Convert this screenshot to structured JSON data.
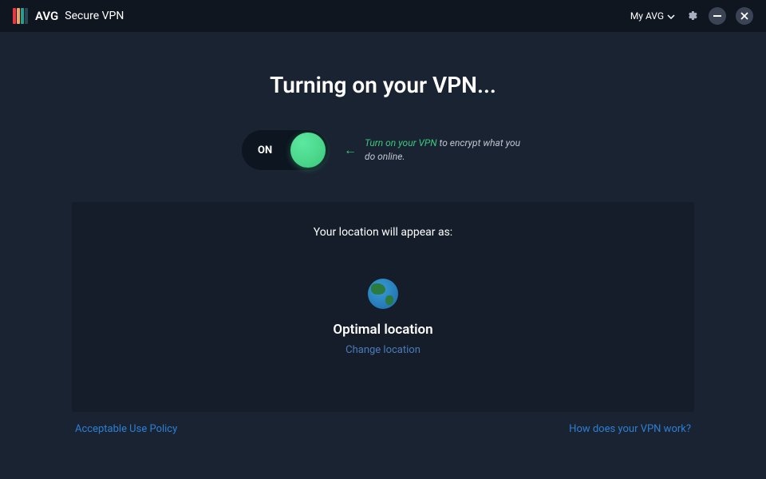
{
  "titlebar": {
    "brand": "AVG",
    "product": "Secure VPN",
    "my_avg_label": "My AVG"
  },
  "main": {
    "title": "Turning on your VPN...",
    "toggle_label": "ON",
    "hint_highlight": "Turn on your VPN",
    "hint_rest": " to encrypt what you do online."
  },
  "location": {
    "panel_title": "Your location will appear as:",
    "current": "Optimal location",
    "change_label": "Change location"
  },
  "footer": {
    "policy_link": "Acceptable Use Policy",
    "help_link": "How does your VPN work?"
  },
  "colors": {
    "accent_green": "#3cc97b",
    "link_blue": "#2d7fd4",
    "muted_blue": "#4a7bb8",
    "panel_bg": "#151d2b",
    "body_bg": "#1a2332"
  }
}
